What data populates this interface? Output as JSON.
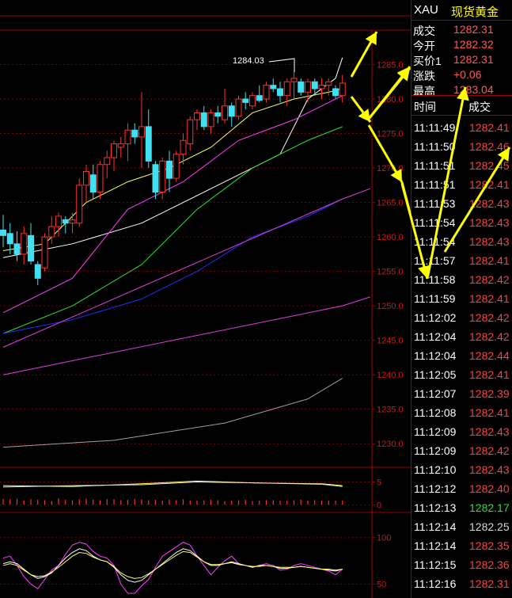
{
  "quote": {
    "symbol": "XAU",
    "name": "现货黄金",
    "rows": [
      {
        "label": "成交",
        "value": "1282.31"
      },
      {
        "label": "今开",
        "value": "1282.32"
      },
      {
        "label": "买价1",
        "value": "1282.31"
      },
      {
        "label": "涨跌",
        "value": "+0.06"
      },
      {
        "label": "最高",
        "value": "1283.04"
      }
    ],
    "table_headers": [
      "时间",
      "成交"
    ],
    "trades": [
      {
        "time": "11:11:49",
        "price": "1282.41",
        "color": "#ff4040"
      },
      {
        "time": "11:11:50",
        "price": "1282.46",
        "color": "#ff4040"
      },
      {
        "time": "11:11:51",
        "price": "1282.45",
        "color": "#ff4040"
      },
      {
        "time": "11:11:51",
        "price": "1282.41",
        "color": "#ff4040"
      },
      {
        "time": "11:11:53",
        "price": "1282.43",
        "color": "#ff4040"
      },
      {
        "time": "11:11:54",
        "price": "1282.43",
        "color": "#ff4040"
      },
      {
        "time": "11:11:54",
        "price": "1282.43",
        "color": "#ff4040"
      },
      {
        "time": "11:11:57",
        "price": "1282.41",
        "color": "#ff4040"
      },
      {
        "time": "11:11:58",
        "price": "1282.42",
        "color": "#ff4040"
      },
      {
        "time": "11:11:59",
        "price": "1282.41",
        "color": "#ff4040"
      },
      {
        "time": "11:12:02",
        "price": "1282.42",
        "color": "#ff4040"
      },
      {
        "time": "11:12:04",
        "price": "1282.42",
        "color": "#ff4040"
      },
      {
        "time": "11:12:04",
        "price": "1282.44",
        "color": "#ff4040"
      },
      {
        "time": "11:12:05",
        "price": "1282.41",
        "color": "#ff4040"
      },
      {
        "time": "11:12:07",
        "price": "1282.39",
        "color": "#ff4040"
      },
      {
        "time": "11:12:08",
        "price": "1282.41",
        "color": "#ff4040"
      },
      {
        "time": "11:12:09",
        "price": "1282.43",
        "color": "#ff4040"
      },
      {
        "time": "11:12:09",
        "price": "1282.42",
        "color": "#ff4040"
      },
      {
        "time": "11:12:10",
        "price": "1282.43",
        "color": "#ff4040"
      },
      {
        "time": "11:12:12",
        "price": "1282.40",
        "color": "#ff4040"
      },
      {
        "time": "11:12:13",
        "price": "1282.17",
        "color": "#33dd33"
      },
      {
        "time": "11:12:14",
        "price": "1282.25",
        "color": "#d8d8d8"
      },
      {
        "time": "11:12:14",
        "price": "1282.35",
        "color": "#ff4040"
      },
      {
        "time": "11:12:15",
        "price": "1282.36",
        "color": "#ff4040"
      },
      {
        "time": "11:12:16",
        "price": "1282.31",
        "color": "#ff4040"
      }
    ]
  },
  "chart_data": [
    {
      "type": "candlestick",
      "ylim": [
        1227.5,
        1290
      ],
      "yticks": [
        "1285.0",
        "1280.0",
        "1275.0",
        "1270.0",
        "1265.0",
        "1260.0",
        "1255.0",
        "1250.0",
        "1245.0",
        "1240.0",
        "1235.0",
        "1230.0"
      ],
      "ytick_values": [
        1285,
        1280,
        1275,
        1270,
        1265,
        1260,
        1255,
        1250,
        1245,
        1240,
        1235,
        1230
      ],
      "annotation": "1284.03",
      "annotation_value": 1284.03,
      "candles": [
        {
          "o": 1261.0,
          "h": 1263.2,
          "l": 1258.5,
          "c": 1260.2
        },
        {
          "o": 1260.5,
          "h": 1262.0,
          "l": 1257.5,
          "c": 1259.0
        },
        {
          "o": 1259.0,
          "h": 1260.8,
          "l": 1256.5,
          "c": 1257.5
        },
        {
          "o": 1257.5,
          "h": 1261.5,
          "l": 1256.0,
          "c": 1260.5
        },
        {
          "o": 1260.2,
          "h": 1262.0,
          "l": 1256.0,
          "c": 1256.5
        },
        {
          "o": 1256.0,
          "h": 1256.5,
          "l": 1253.0,
          "c": 1254.0
        },
        {
          "o": 1255.5,
          "h": 1260.5,
          "l": 1255.0,
          "c": 1260.0
        },
        {
          "o": 1260.0,
          "h": 1263.0,
          "l": 1259.0,
          "c": 1261.5
        },
        {
          "o": 1261.5,
          "h": 1263.5,
          "l": 1260.0,
          "c": 1263.0
        },
        {
          "o": 1262.5,
          "h": 1263.0,
          "l": 1260.5,
          "c": 1262.0
        },
        {
          "o": 1262.0,
          "h": 1263.5,
          "l": 1260.5,
          "c": 1262.5
        },
        {
          "o": 1262.0,
          "h": 1268.5,
          "l": 1261.5,
          "c": 1267.5
        },
        {
          "o": 1267.5,
          "h": 1270.5,
          "l": 1265.0,
          "c": 1269.5
        },
        {
          "o": 1269.0,
          "h": 1270.5,
          "l": 1265.5,
          "c": 1266.5
        },
        {
          "o": 1266.5,
          "h": 1271.0,
          "l": 1265.5,
          "c": 1270.5
        },
        {
          "o": 1270.5,
          "h": 1272.5,
          "l": 1268.5,
          "c": 1271.5
        },
        {
          "o": 1271.5,
          "h": 1274.0,
          "l": 1269.5,
          "c": 1273.5
        },
        {
          "o": 1273.0,
          "h": 1274.5,
          "l": 1271.5,
          "c": 1273.5
        },
        {
          "o": 1273.5,
          "h": 1276.5,
          "l": 1271.0,
          "c": 1275.5
        },
        {
          "o": 1275.5,
          "h": 1276.5,
          "l": 1273.5,
          "c": 1274.5
        },
        {
          "o": 1274.5,
          "h": 1281.0,
          "l": 1270.0,
          "c": 1276.0
        },
        {
          "o": 1276.0,
          "h": 1278.5,
          "l": 1270.0,
          "c": 1271.0
        },
        {
          "o": 1270.5,
          "h": 1271.0,
          "l": 1265.5,
          "c": 1266.5
        },
        {
          "o": 1266.5,
          "h": 1271.5,
          "l": 1265.5,
          "c": 1271.0
        },
        {
          "o": 1271.0,
          "h": 1272.5,
          "l": 1266.5,
          "c": 1268.5
        },
        {
          "o": 1268.5,
          "h": 1272.5,
          "l": 1268.0,
          "c": 1272.0
        },
        {
          "o": 1272.0,
          "h": 1275.0,
          "l": 1270.5,
          "c": 1274.0
        },
        {
          "o": 1273.5,
          "h": 1277.5,
          "l": 1272.5,
          "c": 1277.0
        },
        {
          "o": 1277.0,
          "h": 1278.5,
          "l": 1275.5,
          "c": 1278.0
        },
        {
          "o": 1278.0,
          "h": 1279.0,
          "l": 1275.5,
          "c": 1276.0
        },
        {
          "o": 1276.0,
          "h": 1278.5,
          "l": 1275.0,
          "c": 1278.0
        },
        {
          "o": 1278.0,
          "h": 1279.0,
          "l": 1276.5,
          "c": 1277.5
        },
        {
          "o": 1277.0,
          "h": 1281.5,
          "l": 1276.5,
          "c": 1279.0
        },
        {
          "o": 1279.0,
          "h": 1279.5,
          "l": 1276.0,
          "c": 1277.5
        },
        {
          "o": 1277.5,
          "h": 1280.5,
          "l": 1277.0,
          "c": 1280.0
        },
        {
          "o": 1280.0,
          "h": 1281.0,
          "l": 1278.5,
          "c": 1279.5
        },
        {
          "o": 1279.0,
          "h": 1281.0,
          "l": 1278.5,
          "c": 1280.5
        },
        {
          "o": 1280.5,
          "h": 1282.0,
          "l": 1279.5,
          "c": 1279.8
        },
        {
          "o": 1280.0,
          "h": 1282.5,
          "l": 1279.5,
          "c": 1282.0
        },
        {
          "o": 1282.0,
          "h": 1283.0,
          "l": 1281.0,
          "c": 1281.5
        },
        {
          "o": 1281.5,
          "h": 1282.5,
          "l": 1279.5,
          "c": 1280.5
        },
        {
          "o": 1280.5,
          "h": 1283.0,
          "l": 1279.0,
          "c": 1282.5
        },
        {
          "o": 1282.5,
          "h": 1284.0,
          "l": 1280.0,
          "c": 1283.0
        },
        {
          "o": 1282.5,
          "h": 1283.0,
          "l": 1280.5,
          "c": 1281.0
        },
        {
          "o": 1281.0,
          "h": 1283.0,
          "l": 1279.5,
          "c": 1282.5
        },
        {
          "o": 1282.5,
          "h": 1283.0,
          "l": 1280.5,
          "c": 1281.5
        },
        {
          "o": 1281.5,
          "h": 1283.0,
          "l": 1280.0,
          "c": 1282.0
        },
        {
          "o": 1282.0,
          "h": 1283.0,
          "l": 1280.5,
          "c": 1282.5
        },
        {
          "o": 1281.5,
          "h": 1282.0,
          "l": 1280.0,
          "c": 1280.5
        },
        {
          "o": 1280.5,
          "h": 1283.5,
          "l": 1279.5,
          "c": 1282.3
        }
      ],
      "lines": [
        {
          "color": "#ffffff",
          "points": [
            [
              0,
              1257
            ],
            [
              10,
              1259
            ],
            [
              20,
              1262
            ],
            [
              30,
              1267
            ],
            [
              40,
              1272
            ],
            [
              44,
              1280
            ],
            [
              48,
              1283
            ],
            [
              49,
              1286
            ]
          ]
        },
        {
          "color": "#ffff66",
          "points": [
            [
              0,
              1258
            ],
            [
              6,
              1259
            ],
            [
              12,
              1265
            ],
            [
              18,
              1268
            ],
            [
              24,
              1270
            ],
            [
              30,
              1273
            ],
            [
              36,
              1278
            ],
            [
              42,
              1280
            ],
            [
              47,
              1281
            ],
            [
              49,
              1281.5
            ]
          ]
        },
        {
          "color": "#ff40ff",
          "points": [
            [
              0,
              1249
            ],
            [
              10,
              1254
            ],
            [
              18,
              1264
            ],
            [
              26,
              1268
            ],
            [
              34,
              1274
            ],
            [
              42,
              1277
            ],
            [
              47,
              1279.5
            ],
            [
              49,
              1280.5
            ]
          ]
        },
        {
          "color": "#33dd33",
          "points": [
            [
              0,
              1246
            ],
            [
              10,
              1250
            ],
            [
              20,
              1256
            ],
            [
              28,
              1264
            ],
            [
              36,
              1270
            ],
            [
              44,
              1274
            ],
            [
              49,
              1276
            ]
          ]
        },
        {
          "color": "#2030ff",
          "points": [
            [
              0,
              1246
            ],
            [
              10,
              1248
            ],
            [
              20,
              1251
            ],
            [
              28,
              1255
            ],
            [
              36,
              1260
            ],
            [
              44,
              1263
            ],
            [
              49,
              1265.5
            ]
          ]
        },
        {
          "color": "#e040e0",
          "points": [
            [
              0,
              1244
            ],
            [
              49,
              1265.5
            ],
            [
              53,
              1267
            ]
          ]
        },
        {
          "color": "#e040e0",
          "points": [
            [
              0,
              1240
            ],
            [
              49,
              1250
            ],
            [
              53,
              1251.3
            ]
          ]
        },
        {
          "color": "#a0a0a0",
          "points": [
            [
              0,
              1229.5
            ],
            [
              16,
              1230.5
            ],
            [
              32,
              1233
            ],
            [
              44,
              1236.5
            ],
            [
              49,
              1239.5
            ]
          ]
        }
      ]
    },
    {
      "type": "bar",
      "ylim": [
        -1,
        7
      ],
      "yticks": [
        "5",
        "0"
      ],
      "ytick_values": [
        5,
        0
      ],
      "values": [
        1.3,
        1.2,
        1.3,
        1.0,
        1.2,
        1.1,
        1.0,
        0.8,
        1.4,
        1.1,
        1.0,
        1.2,
        1.3,
        1.1,
        1.0,
        1.2,
        1.2,
        1.0,
        1.1,
        1.3,
        1.2,
        1.0,
        1.1,
        0.9,
        1.1,
        1.0,
        1.2,
        0.9,
        0.9,
        1.0,
        1.1,
        1.0,
        0.8,
        0.9,
        1.0,
        1.1,
        0.8,
        0.9,
        1.0,
        1.0,
        0.9,
        0.9,
        1.0,
        1.1,
        0.9,
        1.0,
        0.9,
        0.9,
        0.9,
        0.9
      ],
      "lines": [
        {
          "color": "#ffff66",
          "points": [
            [
              0,
              4.2
            ],
            [
              10,
              4.0
            ],
            [
              20,
              4.6
            ],
            [
              28,
              5.2
            ],
            [
              36,
              4.8
            ],
            [
              46,
              4.6
            ],
            [
              49,
              4.2
            ]
          ]
        },
        {
          "color": "#e0e0e0",
          "points": [
            [
              0,
              3.9
            ],
            [
              10,
              4.2
            ],
            [
              20,
              4.4
            ],
            [
              28,
              5.0
            ],
            [
              36,
              4.8
            ],
            [
              46,
              4.5
            ],
            [
              49,
              4.0
            ]
          ]
        }
      ]
    },
    {
      "type": "line",
      "ylim": [
        35,
        110
      ],
      "yticks": [
        "100",
        "50"
      ],
      "ytick_values": [
        100,
        50
      ],
      "series": [
        {
          "color": "#ff40ff",
          "values": [
            78,
            80,
            70,
            58,
            50,
            45,
            55,
            65,
            70,
            82,
            92,
            95,
            93,
            85,
            80,
            78,
            70,
            50,
            40,
            40,
            48,
            55,
            68,
            80,
            85,
            90,
            95,
            92,
            80,
            70,
            60,
            68,
            75,
            80,
            72,
            70,
            68,
            70,
            72,
            70,
            65,
            66,
            70,
            72,
            70,
            68,
            66,
            64,
            60,
            66
          ]
        },
        {
          "color": "#ffffff",
          "values": [
            72,
            74,
            72,
            66,
            60,
            56,
            58,
            62,
            70,
            78,
            84,
            88,
            86,
            80,
            76,
            74,
            68,
            60,
            54,
            52,
            54,
            60,
            66,
            72,
            78,
            84,
            88,
            86,
            80,
            74,
            70,
            70,
            72,
            74,
            72,
            70,
            68,
            70,
            70,
            69,
            67,
            67,
            68,
            69,
            68,
            67,
            66,
            65,
            64,
            66
          ]
        },
        {
          "color": "#ffff66",
          "values": [
            70,
            72,
            70,
            65,
            60,
            58,
            59,
            63,
            68,
            74,
            80,
            84,
            83,
            79,
            76,
            74,
            69,
            62,
            58,
            56,
            57,
            61,
            66,
            71,
            76,
            81,
            85,
            84,
            79,
            74,
            71,
            71,
            72,
            73,
            71,
            70,
            69,
            69,
            70,
            69,
            68,
            68,
            68,
            69,
            68,
            67,
            66,
            66,
            65,
            66
          ]
        }
      ]
    }
  ],
  "overlay_arrows": {
    "color": "#ffff00"
  }
}
